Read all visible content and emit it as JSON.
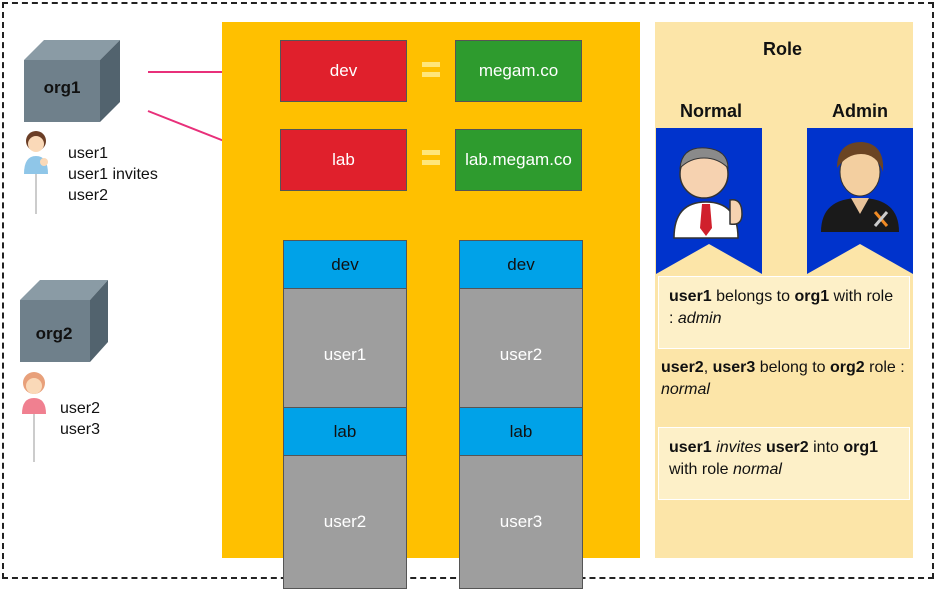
{
  "orgs": [
    {
      "name": "org1",
      "users": [
        "user1",
        "user1 invites",
        "user2"
      ]
    },
    {
      "name": "org2",
      "users": [
        "user2",
        "user3"
      ]
    }
  ],
  "domains": [
    {
      "env": "dev",
      "domain": "megam.co"
    },
    {
      "env": "lab",
      "domain": "lab.megam.co"
    }
  ],
  "assignments": [
    {
      "env": "dev",
      "user": "user1"
    },
    {
      "env": "dev",
      "user": "user2"
    },
    {
      "env": "lab",
      "user": "user2"
    },
    {
      "env": "lab",
      "user": "user3"
    }
  ],
  "role": {
    "title": "Role",
    "normal": "Normal",
    "admin": "Admin"
  },
  "notes": {
    "n1": {
      "a": "user1",
      "b": " belongs to ",
      "c": "org1",
      "d": " with role : ",
      "e": "admin"
    },
    "n2": {
      "a": "user2",
      "b": ", ",
      "c": "user3",
      "d": " belong to ",
      "e": "org2",
      "f": " role : ",
      "g": "normal"
    },
    "n3": {
      "a": "user1",
      "b": " ",
      "c": "invites",
      "d": " ",
      "e": "user2",
      "f": " into ",
      "g": "org1",
      "h": " with role ",
      "i": "normal"
    }
  },
  "colors": {
    "panel": "#FFC000",
    "role_panel": "#FCE5A8",
    "env_box": "#E0202C",
    "domain_box": "#2E9B2E",
    "card_head": "#00A2E8",
    "card_body": "#9E9E9E",
    "badge": "#0033CC",
    "arrow": "#E8307A"
  }
}
